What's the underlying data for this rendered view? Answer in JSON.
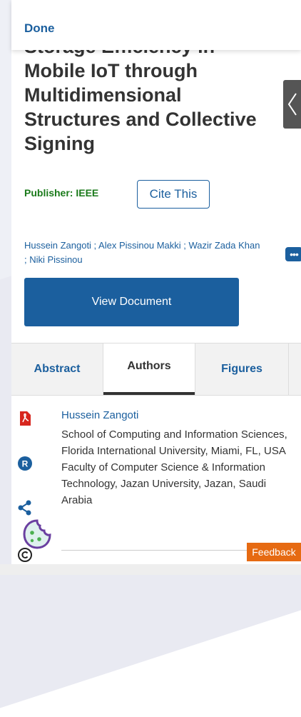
{
  "topbar": {
    "done_label": "Done"
  },
  "article": {
    "title": "Storage Efficiency in Mobile IoT through Multidimensional Structures and Collective Signing",
    "publisher_label": "Publisher: IEEE",
    "cite_label": "Cite This",
    "authors_line": "Hussein Zangoti ; Alex Pissinou Makki ; Wazir Zada Khan ; Niki Pissinou",
    "more_label": "•••",
    "view_document_label": "View Document"
  },
  "tabs": [
    {
      "label": "Abstract"
    },
    {
      "label": "Authors"
    },
    {
      "label": "Figures"
    }
  ],
  "author_detail": {
    "name": "Hussein Zangoti",
    "affiliation": "School of Computing and Information Sciences, Florida International University, Miami, FL, USA Faculty of Computer Science & Information Technology, Jazan University, Jazan, Saudi Arabia"
  },
  "feedback_label": "Feedback",
  "icons": [
    "pdf-icon",
    "rights-icon",
    "share-icon",
    "copyright-icon",
    "cookie-icon",
    "chevron-left-icon"
  ],
  "colors": {
    "brand_blue": "#1b5f9e",
    "publisher_green": "#1a7a1a",
    "feedback_orange": "#e66a12"
  }
}
